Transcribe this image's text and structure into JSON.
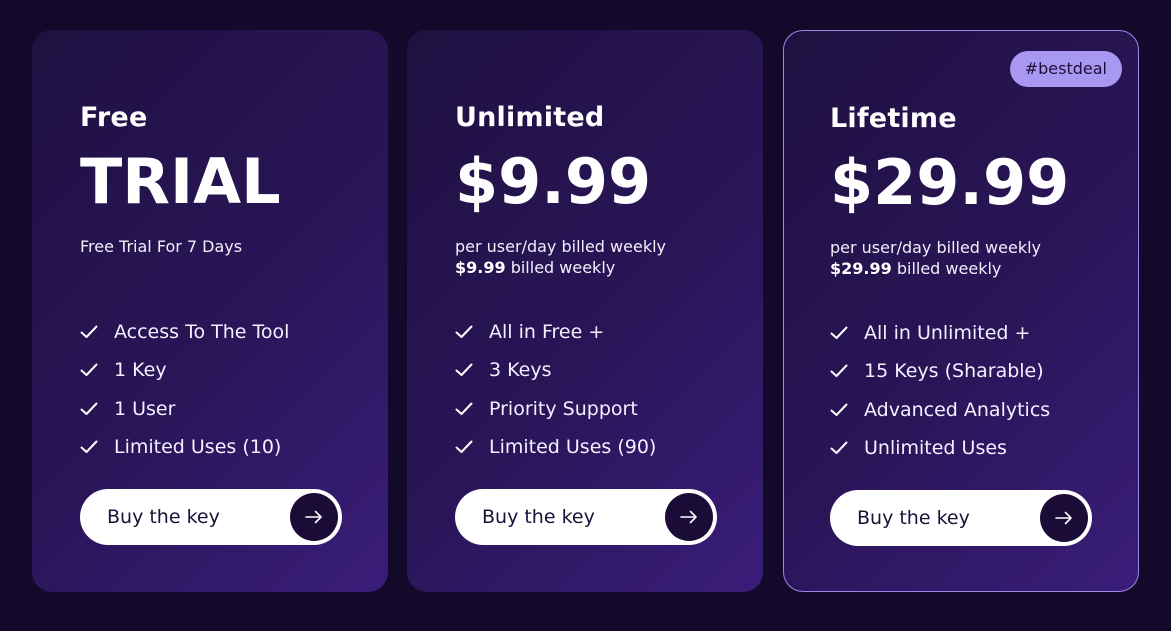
{
  "plans": [
    {
      "name": "Free",
      "price": "TRIAL",
      "subtitle_line1": "Free Trial For 7 Days",
      "features": [
        "Access To The Tool",
        "1 Key",
        "1 User",
        "Limited Uses (10)"
      ],
      "button_label": "Buy the key"
    },
    {
      "name": "Unlimited",
      "price": "$9.99",
      "subtitle_line1": "per user/day billed weekly",
      "subtitle_line2_strong": "$9.99",
      "subtitle_line2_rest": " billed weekly",
      "features": [
        "All in Free +",
        "3 Keys",
        "Priority Support",
        "Limited Uses (90)"
      ],
      "button_label": "Buy the key"
    },
    {
      "name": "Lifetime",
      "price": "$29.99",
      "subtitle_line1": "per user/day billed weekly",
      "subtitle_line2_strong": "$29.99",
      "subtitle_line2_rest": " billed weekly",
      "badge": "#bestdeal",
      "features": [
        "All in Unlimited +",
        "15 Keys (Sharable)",
        "Advanced Analytics",
        "Unlimited Uses"
      ],
      "button_label": "Buy the key"
    }
  ],
  "icons": {
    "feature": "check-icon",
    "button": "arrow-right-icon"
  },
  "colors": {
    "page_background": "#130a2b",
    "card_gradient_start": "#1f1141",
    "card_gradient_end": "#3a1d7a",
    "highlight_border": "#9c86e6",
    "badge_background": "#a998f2",
    "button_background": "#ffffff",
    "arrow_circle": "#1a0c36"
  }
}
